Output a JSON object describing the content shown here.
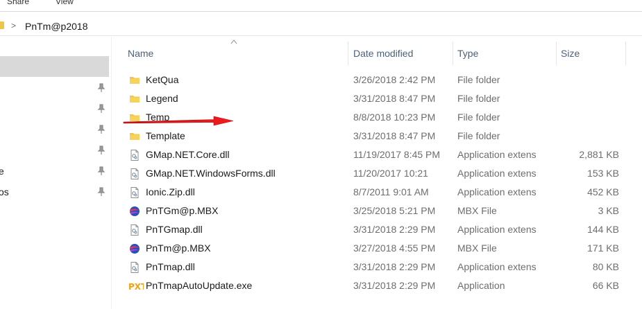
{
  "ribbon": {
    "share_label": "Share",
    "view_label": "View"
  },
  "address": {
    "path": "PnTm@p2018",
    "chevron": ">"
  },
  "nav": {
    "partial_labels": [
      "e",
      "os"
    ]
  },
  "columns": {
    "name": "Name",
    "date": "Date modified",
    "type": "Type",
    "size": "Size"
  },
  "files": [
    {
      "name": "KetQua",
      "date": "3/26/2018 2:42 PM",
      "type": "File folder",
      "size": "",
      "icon": "folder-icon"
    },
    {
      "name": "Legend",
      "date": "3/31/2018 8:47 PM",
      "type": "File folder",
      "size": "",
      "icon": "folder-icon"
    },
    {
      "name": "Temp",
      "date": "8/8/2018 10:23 PM",
      "type": "File folder",
      "size": "",
      "icon": "folder-icon"
    },
    {
      "name": "Template",
      "date": "3/31/2018 8:47 PM",
      "type": "File folder",
      "size": "",
      "icon": "folder-icon"
    },
    {
      "name": "GMap.NET.Core.dll",
      "date": "11/19/2017 8:45 PM",
      "type": "Application extens",
      "size": "2,881 KB",
      "icon": "dll-file-icon"
    },
    {
      "name": "GMap.NET.WindowsForms.dll",
      "date": "11/20/2017 10:21",
      "type": "Application extens",
      "size": "153 KB",
      "icon": "dll-file-icon"
    },
    {
      "name": "Ionic.Zip.dll",
      "date": "8/7/2011 9:01 AM",
      "type": "Application extens",
      "size": "452 KB",
      "icon": "dll-file-icon"
    },
    {
      "name": "PnTGm@p.MBX",
      "date": "3/25/2018 5:21 PM",
      "type": "MBX File",
      "size": "3 KB",
      "icon": "mbx-file-icon"
    },
    {
      "name": "PnTGmap.dll",
      "date": "3/31/2018 2:29 PM",
      "type": "Application extens",
      "size": "144 KB",
      "icon": "dll-file-icon"
    },
    {
      "name": "PnTm@p.MBX",
      "date": "3/27/2018 4:55 PM",
      "type": "MBX File",
      "size": "171 KB",
      "icon": "mbx-file-icon"
    },
    {
      "name": "PnTmap.dll",
      "date": "3/31/2018 2:29 PM",
      "type": "Application extens",
      "size": "80 KB",
      "icon": "dll-file-icon"
    },
    {
      "name": "PnTmapAutoUpdate.exe",
      "date": "3/31/2018 2:29 PM",
      "type": "Application",
      "size": "66 KB",
      "icon": "exe-pxt-icon"
    }
  ],
  "colors": {
    "folder": "#f0c54a",
    "header_text": "#4c607a",
    "arrow": "#e0191b",
    "selected_nav": "#d9d9d9"
  }
}
